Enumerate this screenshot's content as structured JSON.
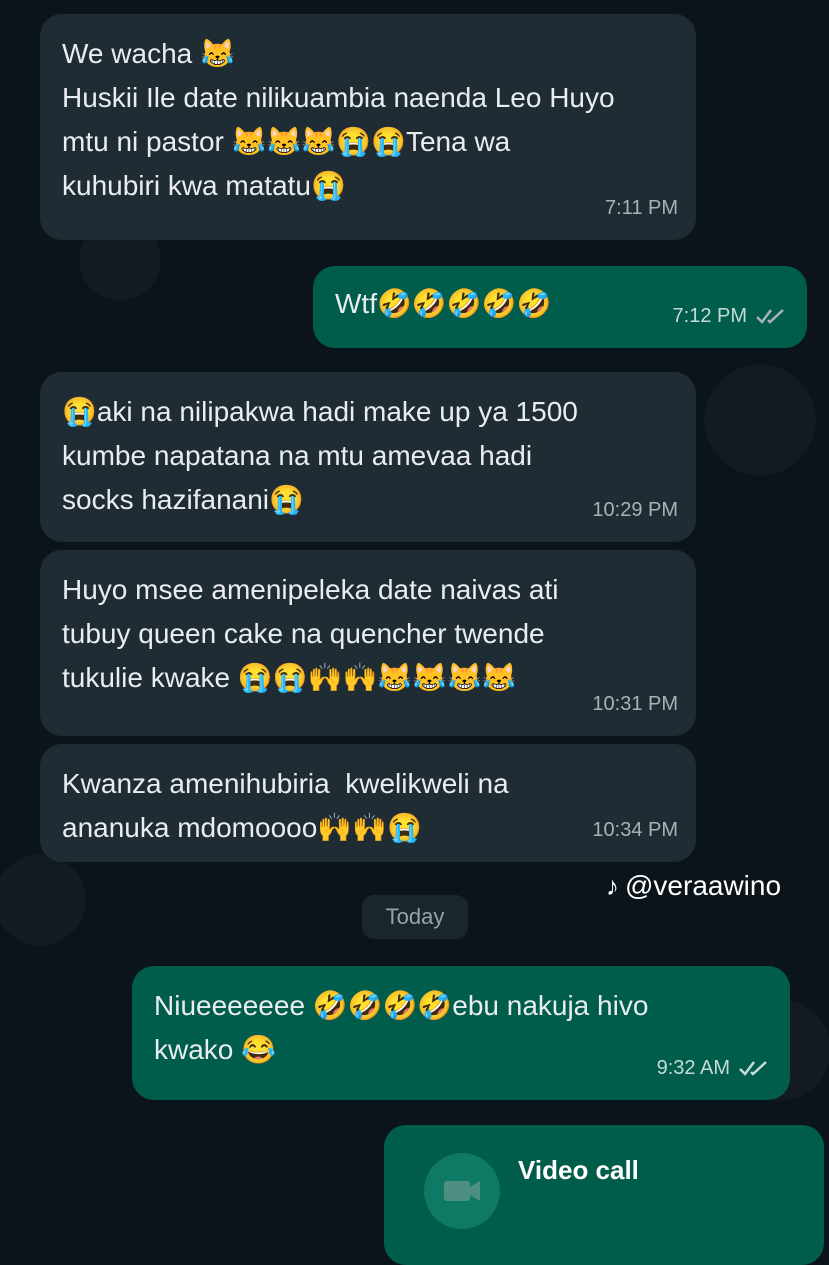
{
  "messages": [
    {
      "direction": "in",
      "text": "We wacha 😹\nHuskii Ile date nilikuambia naenda Leo Huyo\nmtu ni pastor 😹😹😹😭😭Tena wa\nkuhubiri kwa matatu😭",
      "time": "7:11 PM"
    },
    {
      "direction": "out",
      "text": "Wtf🤣🤣🤣🤣🤣",
      "time": "7:12 PM",
      "ticks": "read"
    },
    {
      "direction": "in",
      "text": "😭aki na nilipakwa hadi make up ya 1500\nkumbe napatana na mtu amevaa hadi\nsocks hazifanani😭",
      "time": "10:29 PM"
    },
    {
      "direction": "in",
      "text": "Huyo msee amenipeleka date naivas ati\ntubuy queen cake na quencher twende\ntukulie kwake 😭😭🙌🙌😹😹😹😹",
      "time": "10:31 PM"
    },
    {
      "direction": "in",
      "text": "Kwanza amenihubiria  kwelikweli na\nananuka mdomoooo🙌🙌😭",
      "time": "10:34 PM"
    },
    {
      "direction": "out",
      "text": "Niueeeeeee 🤣🤣🤣🤣ebu nakuja hivo\nkwako 😂",
      "time": "9:32 AM",
      "ticks": "read"
    }
  ],
  "date_separator": "Today",
  "watermark": {
    "icon": "tiktok-icon",
    "handle": "@veraawino"
  },
  "video_call": {
    "label": "Video call",
    "icon": "video-camera-icon"
  },
  "colors": {
    "background": "#0b141a",
    "incoming": "#1f2c34",
    "outgoing": "#005c4b",
    "ticks": "#a6b3b9"
  }
}
